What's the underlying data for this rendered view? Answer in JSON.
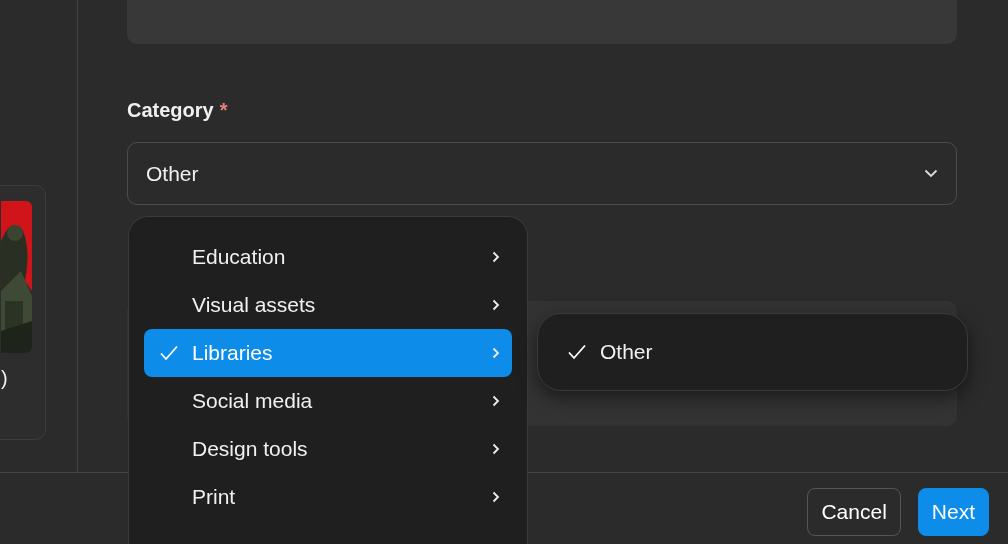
{
  "preview_card": {
    "caption": ")"
  },
  "category": {
    "label": "Category",
    "required_mark": "*",
    "value": "Other"
  },
  "category_menu": {
    "items": [
      {
        "label": "Education",
        "selected": false
      },
      {
        "label": "Visual assets",
        "selected": false
      },
      {
        "label": "Libraries",
        "selected": true
      },
      {
        "label": "Social media",
        "selected": false
      },
      {
        "label": "Design tools",
        "selected": false
      },
      {
        "label": "Print",
        "selected": false
      }
    ]
  },
  "submenu": {
    "items": [
      {
        "label": "Other",
        "selected": true
      }
    ]
  },
  "buttons": [
    {
      "label": "Cancel",
      "kind": "secondary"
    },
    {
      "label": "Next",
      "kind": "primary"
    }
  ]
}
